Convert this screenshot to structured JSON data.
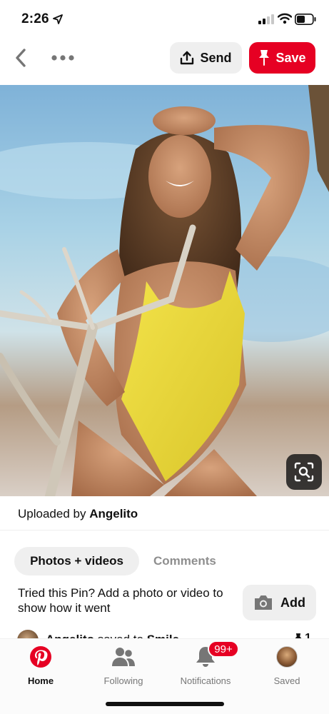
{
  "status_bar": {
    "time": "2:26",
    "location_icon": "location-arrow-icon",
    "signal_icon": "cellular-signal-icon",
    "wifi_icon": "wifi-icon",
    "battery_icon": "battery-icon"
  },
  "top_bar": {
    "back_icon": "chevron-left-icon",
    "more_icon": "more-dots-icon",
    "send_label": "Send",
    "save_label": "Save"
  },
  "pin": {
    "uploaded_prefix": "Uploaded by ",
    "uploader": "Angelito",
    "lens_icon": "visual-search-icon"
  },
  "tabs": {
    "photos_label": "Photos + videos",
    "comments_label": "Comments"
  },
  "tried": {
    "text": "Tried this Pin? Add a photo or video to show how it went",
    "add_label": "Add"
  },
  "activity": {
    "user": "Angelito",
    "action": " saved to ",
    "board": "Smile",
    "count": "1"
  },
  "nav": {
    "home": "Home",
    "following": "Following",
    "notifications": "Notifications",
    "notifications_badge": "99+",
    "saved": "Saved"
  },
  "colors": {
    "brand_red": "#e60023",
    "button_grey": "#efefef",
    "muted_text": "#8e8e8e"
  }
}
